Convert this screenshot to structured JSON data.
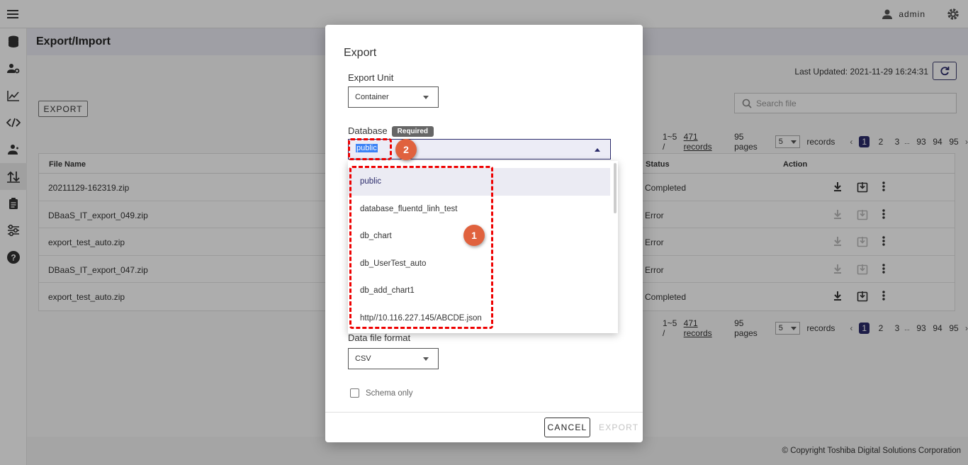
{
  "header": {
    "user": "admin"
  },
  "page": {
    "title": "Export/Import",
    "last_updated": "Last Updated: 2021-11-29 16:24:31",
    "export_button": "EXPORT",
    "search_placeholder": "Search file"
  },
  "pager": {
    "range": "1~5 /",
    "records_link": "471 records",
    "pages": "95 pages",
    "page_size": "5",
    "records_suffix": "records",
    "page_numbers": [
      "1",
      "2",
      "3",
      "...",
      "93",
      "94",
      "95"
    ],
    "current_page": "1"
  },
  "table": {
    "columns": {
      "file_name": "File Name",
      "status": "Status",
      "action": "Action"
    },
    "rows": [
      {
        "file": "20211129-162319.zip",
        "status": "Completed"
      },
      {
        "file": "DBaaS_IT_export_049.zip",
        "status": "Error"
      },
      {
        "file": "export_test_auto.zip",
        "status": "Error"
      },
      {
        "file": "DBaaS_IT_export_047.zip",
        "status": "Error"
      },
      {
        "file": "export_test_auto.zip",
        "status": "Completed"
      }
    ]
  },
  "footer": {
    "copyright": "© Copyright Toshiba Digital Solutions Corporation"
  },
  "dialog": {
    "title": "Export",
    "export_unit_label": "Export Unit",
    "export_unit_value": "Container",
    "database_label": "Database",
    "required_badge": "Required",
    "database_value": "public",
    "database_options": [
      "public",
      "database_fluentd_linh_test",
      "db_chart",
      "db_UserTest_auto",
      "db_add_chart1",
      "http//10.116.227.145/ABCDE.json"
    ],
    "data_format_label": "Data file format",
    "data_format_value": "CSV",
    "schema_only_label": "Schema only",
    "cancel_button": "CANCEL",
    "export_button": "EXPORT"
  },
  "annotations": {
    "badge1": "1",
    "badge2": "2"
  },
  "colors": {
    "accent": "#2b2b6b",
    "annotation": "#e0623e",
    "dash": "#ee0000"
  }
}
